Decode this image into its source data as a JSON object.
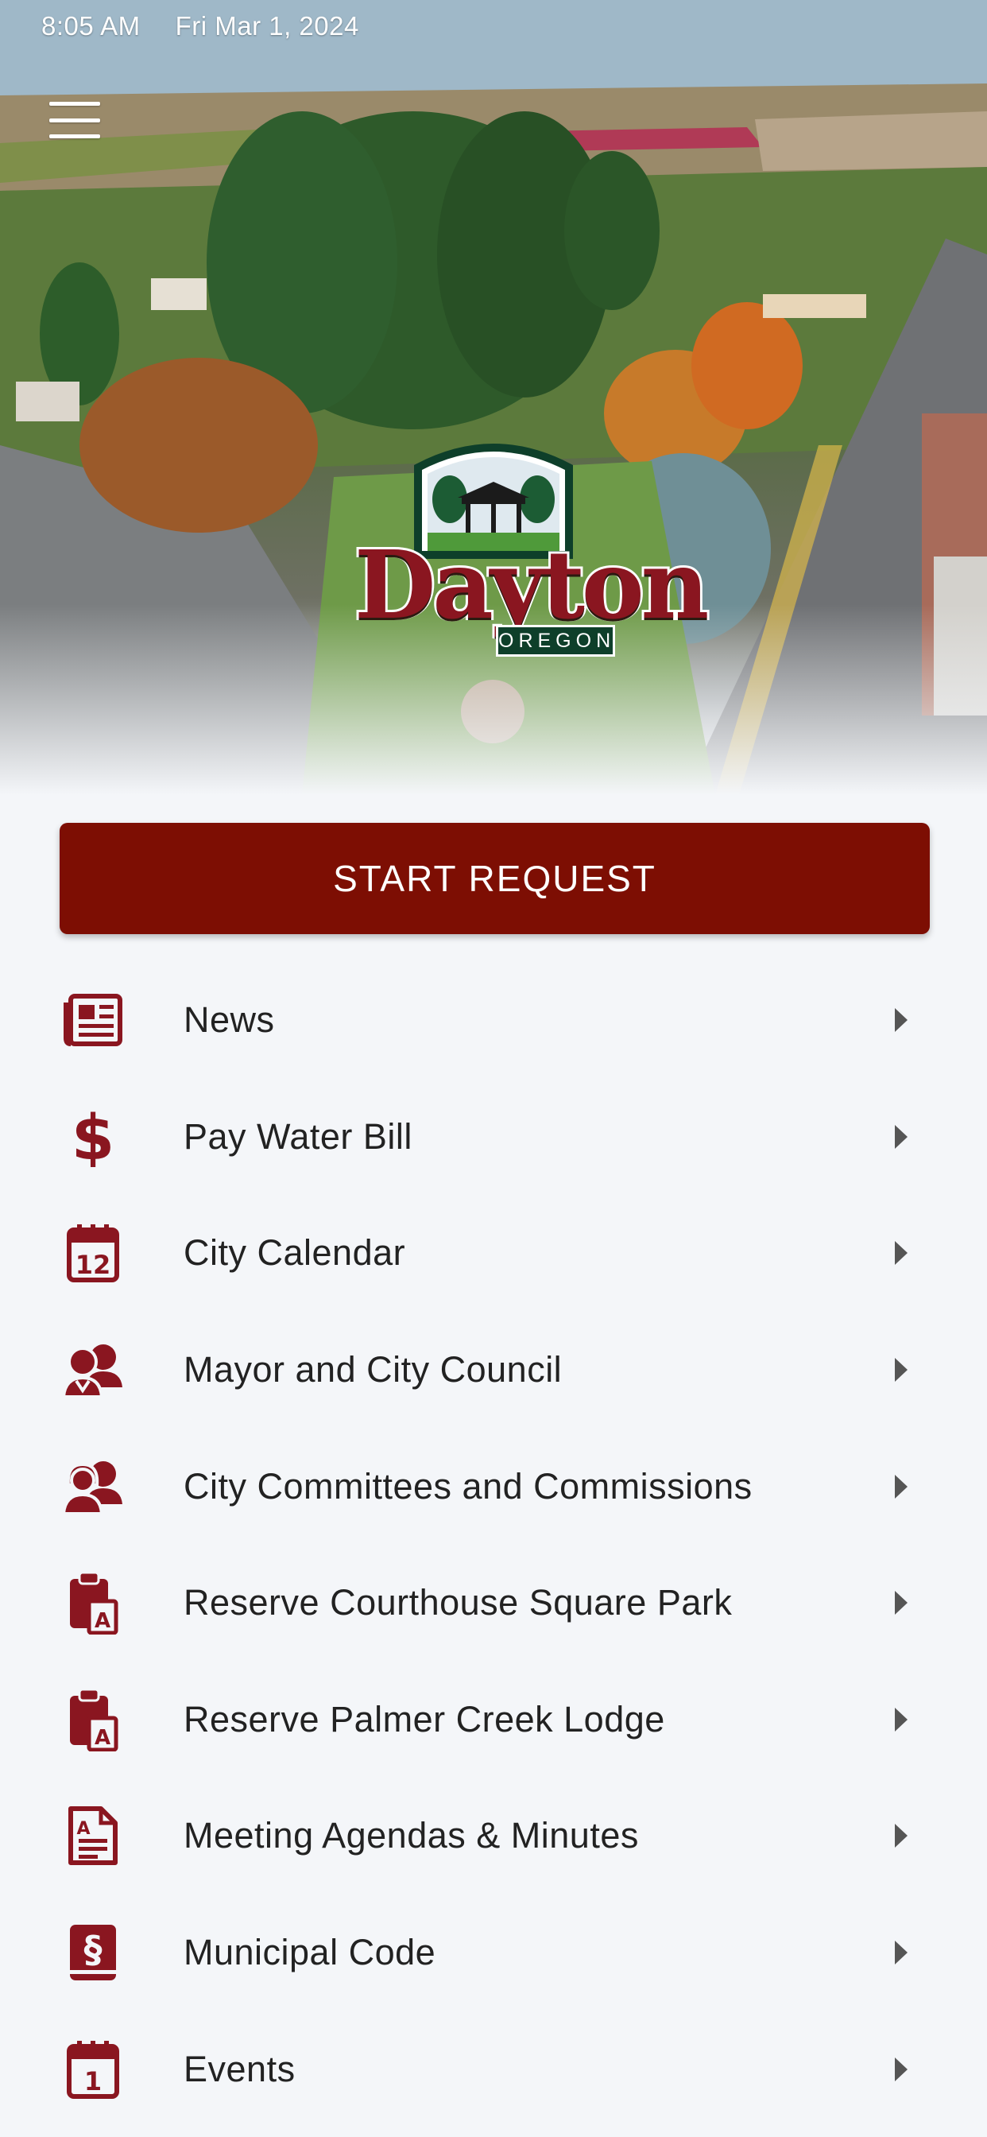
{
  "status_bar": {
    "time": "8:05 AM",
    "date": "Fri Mar 1, 2024"
  },
  "colors": {
    "accent": "#7d0e03",
    "icon": "#8a1620",
    "background": "#f4f6f9"
  },
  "logo": {
    "title": "Dayton",
    "subtitle": "OREGON"
  },
  "start_request": {
    "label": "START REQUEST"
  },
  "menu": [
    {
      "label": "News",
      "icon": "newspaper-icon"
    },
    {
      "label": "Pay Water Bill",
      "icon": "dollar-icon"
    },
    {
      "label": "City Calendar",
      "icon": "calendar-icon"
    },
    {
      "label": "Mayor and City Council",
      "icon": "users-icon"
    },
    {
      "label": "City Committees and Commissions",
      "icon": "group-icon"
    },
    {
      "label": "Reserve Courthouse Square Park",
      "icon": "clipboard-icon"
    },
    {
      "label": "Reserve Palmer Creek Lodge",
      "icon": "clipboard-icon"
    },
    {
      "label": "Meeting Agendas & Minutes",
      "icon": "document-icon"
    },
    {
      "label": "Municipal Code",
      "icon": "law-book-icon"
    },
    {
      "label": "Events",
      "icon": "event-calendar-icon"
    }
  ]
}
